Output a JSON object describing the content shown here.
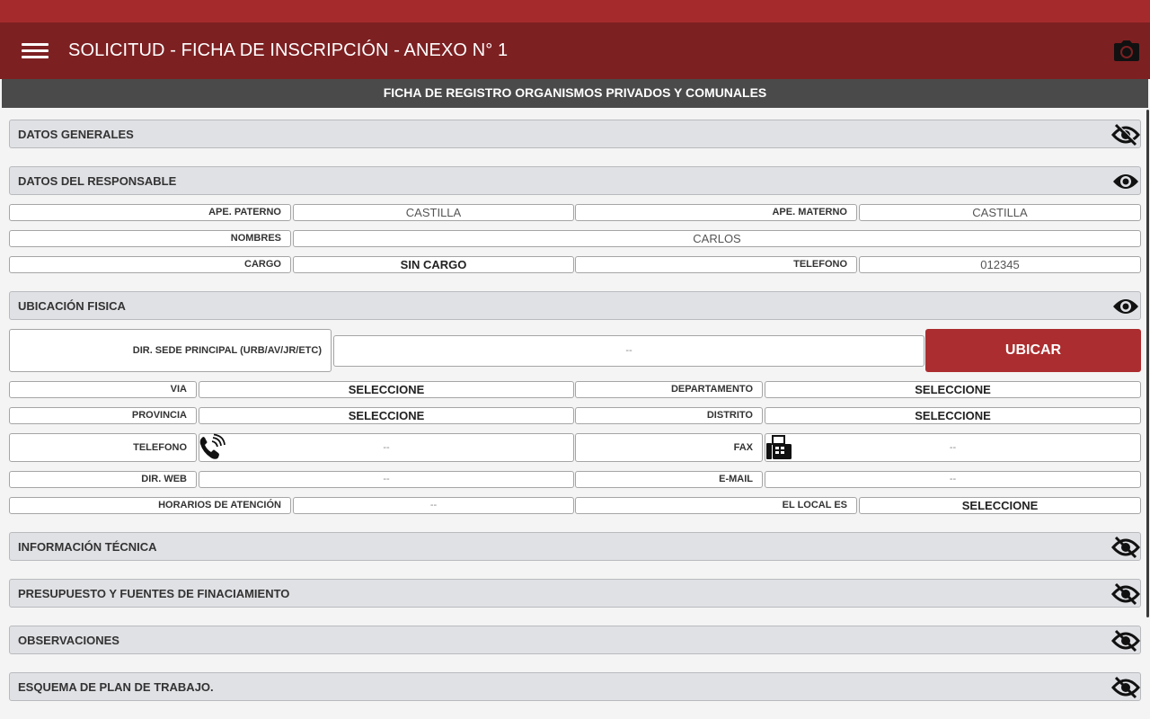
{
  "app_bar": {
    "title": "SOLICITUD - FICHA DE INSCRIPCIÓN - ANEXO N° 1"
  },
  "subheader": {
    "title": "FICHA DE REGISTRO ORGANISMOS PRIVADOS Y COMUNALES"
  },
  "sections": {
    "datos_generales": {
      "title": "DATOS GENERALES",
      "visibility_icon": "eye-off-icon"
    },
    "datos_responsable": {
      "title": "DATOS DEL RESPONSABLE",
      "visibility_icon": "eye-icon"
    },
    "ubicacion": {
      "title": "UBICACIÓN FISICA",
      "visibility_icon": "eye-icon"
    },
    "info_tecnica": {
      "title": "INFORMACIÓN TÉCNICA",
      "visibility_icon": "eye-off-icon"
    },
    "presupuesto": {
      "title": "PRESUPUESTO Y FUENTES DE FINACIAMIENTO",
      "visibility_icon": "eye-off-icon"
    },
    "observaciones": {
      "title": "OBSERVACIONES",
      "visibility_icon": "eye-off-icon"
    },
    "esquema": {
      "title": "ESQUEMA DE PLAN DE TRABAJO.",
      "visibility_icon": "eye-off-icon"
    }
  },
  "responsable": {
    "ape_paterno_label": "APE. PATERNO",
    "ape_paterno_value": "CASTILLA",
    "ape_materno_label": "APE. MATERNO",
    "ape_materno_value": "CASTILLA",
    "nombres_label": "NOMBRES",
    "nombres_value": "CARLOS",
    "cargo_label": "CARGO",
    "cargo_value": "SIN CARGO",
    "telefono_label": "TELEFONO",
    "telefono_value": "012345"
  },
  "ubicacion": {
    "dir_sede_label": "DIR. SEDE PRINCIPAL (URB/AV/JR/ETC)",
    "dir_sede_value": "--",
    "ubicar_label": "UBICAR",
    "via_label": "VIA",
    "via_value": "SELECCIONE",
    "departamento_label": "DEPARTAMENTO",
    "departamento_value": "SELECCIONE",
    "provincia_label": "PROVINCIA",
    "provincia_value": "SELECCIONE",
    "distrito_label": "DISTRITO",
    "distrito_value": "SELECCIONE",
    "telefono_label": "TELEFONO",
    "telefono_value": "--",
    "fax_label": "FAX",
    "fax_value": "--",
    "dir_web_label": "DIR. WEB",
    "dir_web_value": "--",
    "email_label": "E-MAIL",
    "email_value": "--",
    "horarios_label": "HORARIOS DE ATENCIÓN",
    "horarios_value": "--",
    "local_label": "EL LOCAL ES",
    "local_value": "SELECCIONE"
  },
  "colors": {
    "status_bar": "#a52a2c",
    "app_bar": "#7d2022",
    "subheader": "#4a4a4a",
    "accent_button": "#ac2d2f",
    "section_bg": "#e0e1e5"
  }
}
